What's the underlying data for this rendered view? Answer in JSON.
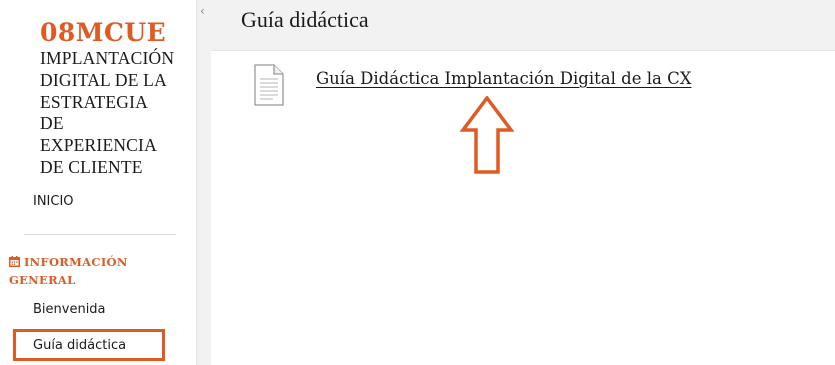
{
  "sidebar": {
    "course_code": "08MCUE",
    "course_title_lines": [
      "IMPLANTACIÓN",
      "DIGITAL DE LA",
      "ESTRATEGIA",
      "DE",
      "EXPERIENCIA",
      "DE CLIENTE"
    ],
    "nav_inicio": "INICIO",
    "section_heading_lines": [
      "INFORMACIÓN",
      "GENERAL"
    ],
    "section_icon": "calendar-icon",
    "nav_bienvenida": "Bienvenida",
    "nav_guia": "Guía didáctica"
  },
  "collapse": {
    "icon": "chevron-left-icon",
    "glyph": "‹"
  },
  "main": {
    "page_title": "Guía didáctica",
    "document": {
      "icon": "document-icon",
      "link_text": "Guía Didáctica Implantación Digital de la CX"
    },
    "annotation_icon": "up-arrow-icon"
  },
  "colors": {
    "accent": "#e05a24",
    "header_bg": "#f2f2f2",
    "text": "#1a1a1a"
  }
}
